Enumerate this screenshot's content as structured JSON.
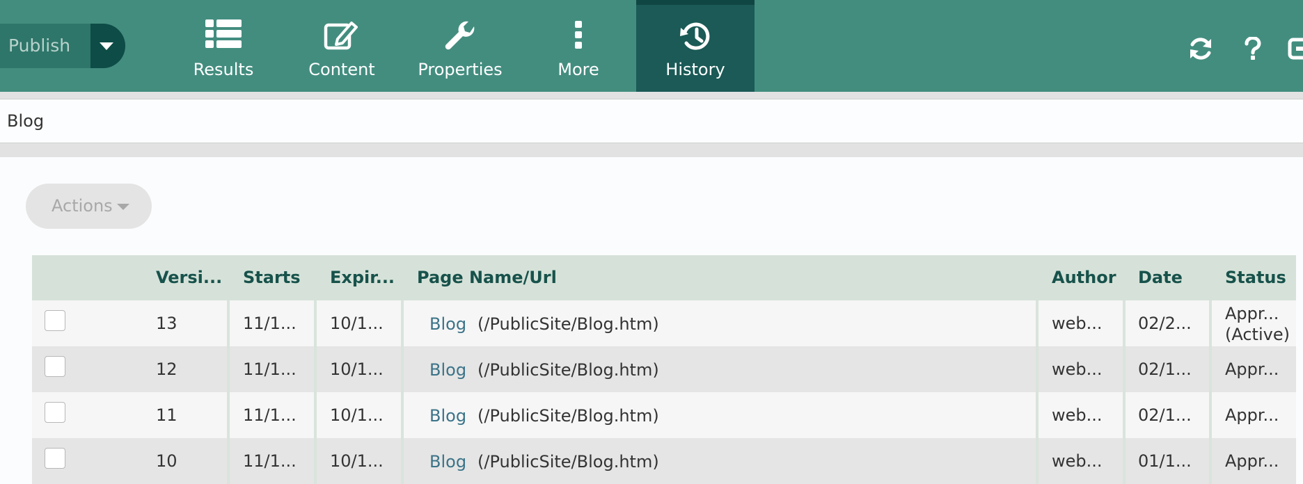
{
  "toolbar": {
    "publish_label": "Publish",
    "items": [
      {
        "label": "Results",
        "icon": "list-icon"
      },
      {
        "label": "Content",
        "icon": "edit-icon"
      },
      {
        "label": "Properties",
        "icon": "wrench-icon"
      },
      {
        "label": "More",
        "icon": "more-vertical-icon"
      },
      {
        "label": "History",
        "icon": "history-icon",
        "active": true
      }
    ],
    "right_icons": [
      "refresh-icon",
      "help-icon",
      "exit-icon"
    ]
  },
  "page_title": "Blog",
  "actions_label": "Actions",
  "table": {
    "headers": [
      "Versi...",
      "Starts",
      "Expir...",
      "Page Name/Url",
      "Author",
      "Date",
      "Status"
    ],
    "rows": [
      {
        "version": "13",
        "starts": "11/1...",
        "expires": "10/1...",
        "page_name": "Blog",
        "url": "(/PublicSite/Blog.htm)",
        "author": "web...",
        "date": "02/2...",
        "status": "Appr...",
        "status_note": "(Active)"
      },
      {
        "version": "12",
        "starts": "11/1...",
        "expires": "10/1...",
        "page_name": "Blog",
        "url": "(/PublicSite/Blog.htm)",
        "author": "web...",
        "date": "02/1...",
        "status": "Appr..."
      },
      {
        "version": "11",
        "starts": "11/1...",
        "expires": "10/1...",
        "page_name": "Blog",
        "url": "(/PublicSite/Blog.htm)",
        "author": "web...",
        "date": "02/1...",
        "status": "Appr..."
      },
      {
        "version": "10",
        "starts": "11/1...",
        "expires": "10/1...",
        "page_name": "Blog",
        "url": "(/PublicSite/Blog.htm)",
        "author": "web...",
        "date": "01/1...",
        "status": "Appr..."
      }
    ]
  },
  "colors": {
    "toolbar": "#438d7f",
    "toolbar_active": "#1b5a56",
    "header_row": "#d6e2d9",
    "header_text": "#17524b",
    "link": "#3b7388"
  }
}
